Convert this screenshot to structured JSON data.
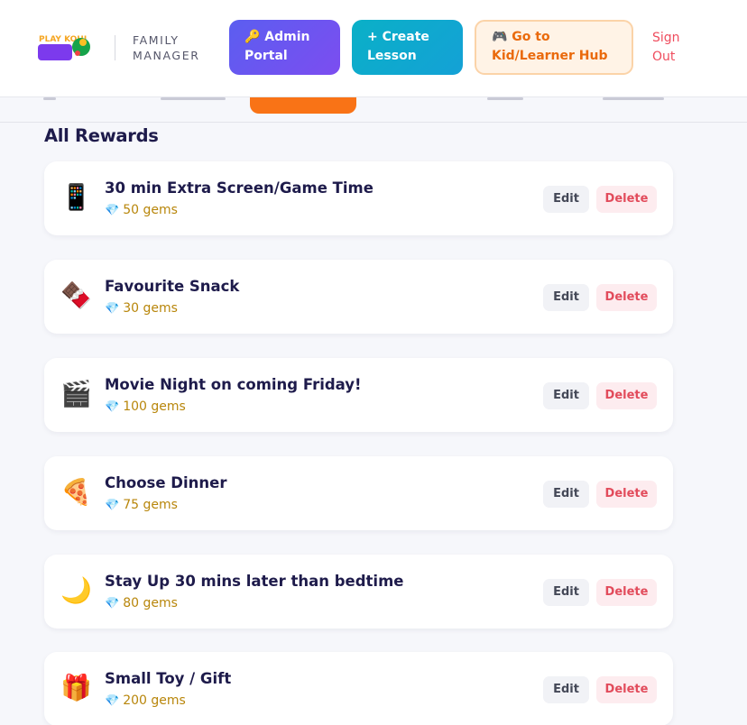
{
  "header": {
    "logo_text": "PLAY KOHI",
    "brand_sub_line1": "FAMILY",
    "brand_sub_line2": "MANAGER",
    "admin_icon": "key-icon",
    "admin_line1": "🔑 Admin",
    "admin_line2": "Portal",
    "create_line1": "+ Create",
    "create_line2": "Lesson",
    "hub_icon": "game-controller-icon",
    "hub_line1": "🎮 Go to",
    "hub_line2": "Kid/Learner Hub",
    "signout_line1": "Sign",
    "signout_line2": "Out"
  },
  "colors": {
    "accent_orange": "#f97316",
    "admin_purple": "#5b5ef0",
    "create_teal": "#0ab0c7",
    "danger_red": "#e24b5b",
    "gems_gold": "#b8860b"
  },
  "section": {
    "title": "All Rewards"
  },
  "rewards": [
    {
      "emoji": "📱",
      "icon": "phone-icon",
      "title": "30 min Extra Screen/Game Time",
      "gems": "50 gems",
      "edit": "Edit",
      "delete": "Delete"
    },
    {
      "emoji": "🍫",
      "icon": "chocolate-icon",
      "title": "Favourite Snack",
      "gems": "30 gems",
      "edit": "Edit",
      "delete": "Delete"
    },
    {
      "emoji": "🎬",
      "icon": "clapperboard-icon",
      "title": "Movie Night on coming Friday!",
      "gems": "100 gems",
      "edit": "Edit",
      "delete": "Delete"
    },
    {
      "emoji": "🍕",
      "icon": "pizza-icon",
      "title": "Choose Dinner",
      "gems": "75 gems",
      "edit": "Edit",
      "delete": "Delete"
    },
    {
      "emoji": "🌙",
      "icon": "moon-icon",
      "title": "Stay Up 30 mins later than bedtime",
      "gems": "80 gems",
      "edit": "Edit",
      "delete": "Delete"
    },
    {
      "emoji": "🎁",
      "icon": "gift-icon",
      "title": "Small Toy / Gift",
      "gems": "200 gems",
      "edit": "Edit",
      "delete": "Delete"
    }
  ]
}
